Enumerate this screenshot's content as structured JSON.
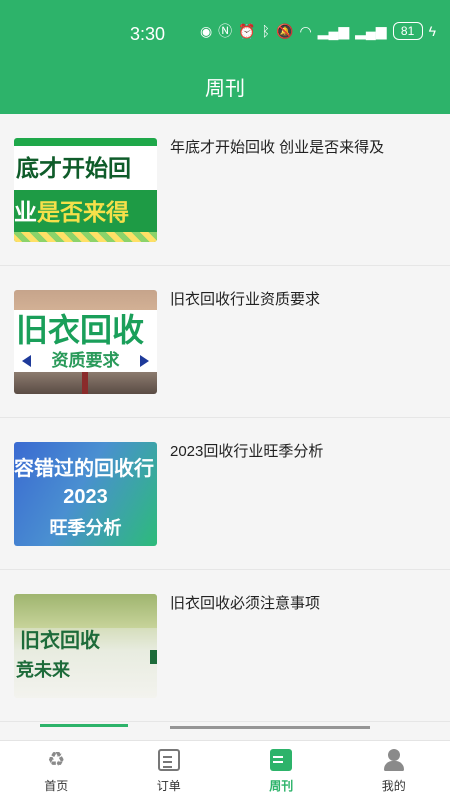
{
  "status_bar": {
    "time": "3:30",
    "icons": [
      "eye-icon",
      "nfc-icon",
      "alarm-icon",
      "bluetooth-icon",
      "mute-icon",
      "wifi-icon",
      "signal-4g-icon",
      "signal-5g-icon",
      "battery-icon",
      "charging-icon"
    ],
    "battery": "81"
  },
  "header": {
    "title": "周刊"
  },
  "articles": [
    {
      "title": "年底才开始回收 创业是否来得及",
      "thumb_line1": "底才开始回",
      "thumb_line2_a": "业",
      "thumb_line2_b": "是否来得"
    },
    {
      "title": "旧衣回收行业资质要求",
      "thumb_line1": "旧衣回收",
      "thumb_line2": "资质要求"
    },
    {
      "title": "2023回收行业旺季分析",
      "thumb_line1": "容错过的回收行",
      "thumb_line2": "2023",
      "thumb_line3": "旺季分析"
    },
    {
      "title": "旧衣回收必须注意事项",
      "thumb_line1": "旧衣回收",
      "thumb_line2": "竞未来"
    }
  ],
  "nav": {
    "items": [
      {
        "label": "首页",
        "icon": "recycle-icon"
      },
      {
        "label": "订单",
        "icon": "clipboard-icon"
      },
      {
        "label": "周刊",
        "icon": "document-icon",
        "active": true
      },
      {
        "label": "我的",
        "icon": "person-icon"
      }
    ]
  },
  "colors": {
    "brand_green": "#2db36a",
    "background": "#f5f5f5"
  }
}
